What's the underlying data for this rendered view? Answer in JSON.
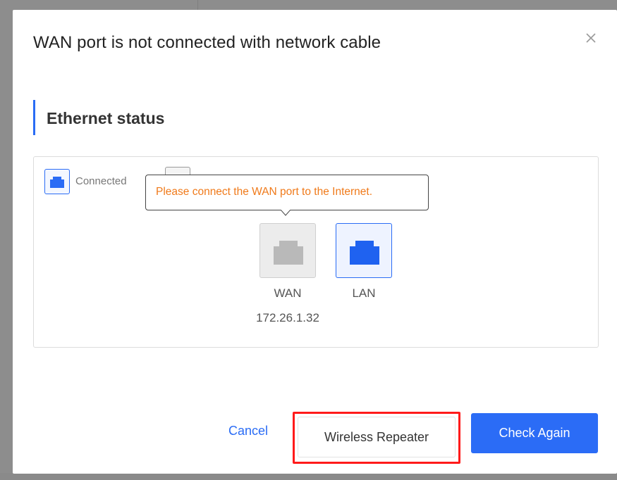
{
  "modal": {
    "title": "WAN port is not connected with network cable",
    "section_title": "Ethernet status"
  },
  "legend": {
    "connected_label": "Connected"
  },
  "tooltip": {
    "text": "Please connect the WAN port to the Internet."
  },
  "ports": {
    "wan": {
      "label": "WAN",
      "ip": "172.26.1.32",
      "status": "disconnected"
    },
    "lan": {
      "label": "LAN",
      "status": "connected"
    }
  },
  "buttons": {
    "cancel": "Cancel",
    "wireless_repeater": "Wireless Repeater",
    "check_again": "Check Again"
  },
  "colors": {
    "accent": "#2a6cf5",
    "warning_text": "#f07a1a",
    "highlight": "#ff1a1a",
    "port_inactive": "#b9b9b9"
  },
  "icons": {
    "close": "close-icon",
    "ethernet": "ethernet-port-icon"
  }
}
